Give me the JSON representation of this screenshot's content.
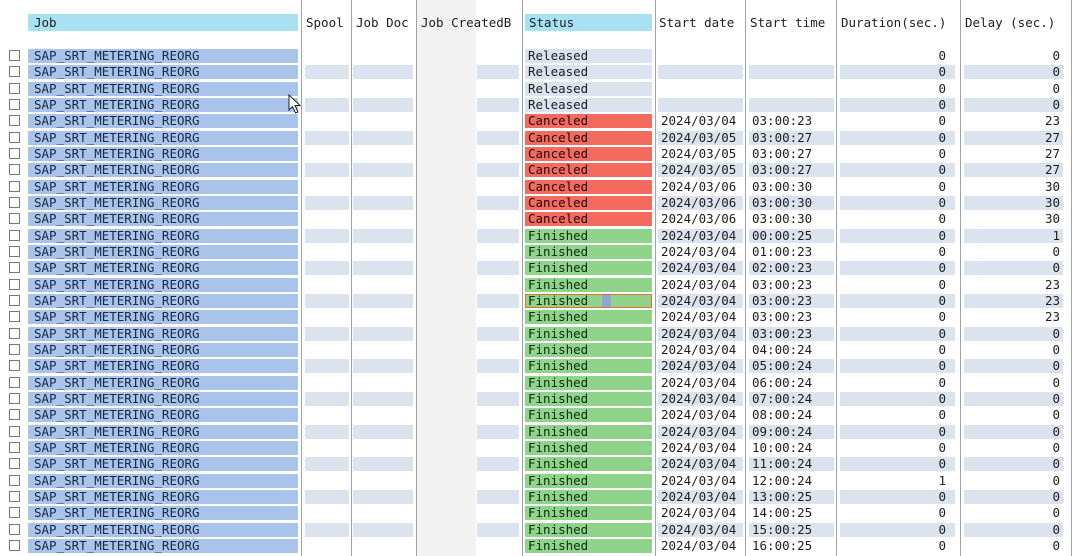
{
  "columns": {
    "job": "Job",
    "spool": "Spool",
    "job_doc": "Job Doc",
    "job_created_by": "Job CreatedB",
    "status": "Status",
    "start_date": "Start date",
    "start_time": "Start time",
    "duration": "Duration(sec.)",
    "delay": "Delay (sec.)"
  },
  "status_colors": {
    "Released": "#dbe3ee",
    "Canceled": "#f56a5e",
    "Finished": "#8fd48a"
  },
  "rows": [
    {
      "job": "SAP_SRT_METERING_REORG",
      "status": "Released",
      "start_date": "",
      "start_time": "",
      "duration": "0",
      "delay": "0"
    },
    {
      "job": "SAP_SRT_METERING_REORG",
      "status": "Released",
      "start_date": "",
      "start_time": "",
      "duration": "0",
      "delay": "0"
    },
    {
      "job": "SAP_SRT_METERING_REORG",
      "status": "Released",
      "start_date": "",
      "start_time": "",
      "duration": "0",
      "delay": "0"
    },
    {
      "job": "SAP_SRT_METERING_REORG",
      "status": "Released",
      "start_date": "",
      "start_time": "",
      "duration": "0",
      "delay": "0"
    },
    {
      "job": "SAP_SRT_METERING_REORG",
      "status": "Canceled",
      "start_date": "2024/03/04",
      "start_time": "03:00:23",
      "duration": "0",
      "delay": "23"
    },
    {
      "job": "SAP_SRT_METERING_REORG",
      "status": "Canceled",
      "start_date": "2024/03/05",
      "start_time": "03:00:27",
      "duration": "0",
      "delay": "27"
    },
    {
      "job": "SAP_SRT_METERING_REORG",
      "status": "Canceled",
      "start_date": "2024/03/05",
      "start_time": "03:00:27",
      "duration": "0",
      "delay": "27"
    },
    {
      "job": "SAP_SRT_METERING_REORG",
      "status": "Canceled",
      "start_date": "2024/03/05",
      "start_time": "03:00:27",
      "duration": "0",
      "delay": "27"
    },
    {
      "job": "SAP_SRT_METERING_REORG",
      "status": "Canceled",
      "start_date": "2024/03/06",
      "start_time": "03:00:30",
      "duration": "0",
      "delay": "30"
    },
    {
      "job": "SAP_SRT_METERING_REORG",
      "status": "Canceled",
      "start_date": "2024/03/06",
      "start_time": "03:00:30",
      "duration": "0",
      "delay": "30"
    },
    {
      "job": "SAP_SRT_METERING_REORG",
      "status": "Canceled",
      "start_date": "2024/03/06",
      "start_time": "03:00:30",
      "duration": "0",
      "delay": "30"
    },
    {
      "job": "SAP_SRT_METERING_REORG",
      "status": "Finished",
      "start_date": "2024/03/04",
      "start_time": "00:00:25",
      "duration": "0",
      "delay": "1"
    },
    {
      "job": "SAP_SRT_METERING_REORG",
      "status": "Finished",
      "start_date": "2024/03/04",
      "start_time": "01:00:23",
      "duration": "0",
      "delay": "0"
    },
    {
      "job": "SAP_SRT_METERING_REORG",
      "status": "Finished",
      "start_date": "2024/03/04",
      "start_time": "02:00:23",
      "duration": "0",
      "delay": "0"
    },
    {
      "job": "SAP_SRT_METERING_REORG",
      "status": "Finished",
      "start_date": "2024/03/04",
      "start_time": "03:00:23",
      "duration": "0",
      "delay": "23"
    },
    {
      "job": "SAP_SRT_METERING_REORG",
      "status": "Finished",
      "start_date": "2024/03/04",
      "start_time": "03:00:23",
      "duration": "0",
      "delay": "23",
      "focused": true
    },
    {
      "job": "SAP_SRT_METERING_REORG",
      "status": "Finished",
      "start_date": "2024/03/04",
      "start_time": "03:00:23",
      "duration": "0",
      "delay": "23"
    },
    {
      "job": "SAP_SRT_METERING_REORG",
      "status": "Finished",
      "start_date": "2024/03/04",
      "start_time": "03:00:23",
      "duration": "0",
      "delay": "0"
    },
    {
      "job": "SAP_SRT_METERING_REORG",
      "status": "Finished",
      "start_date": "2024/03/04",
      "start_time": "04:00:24",
      "duration": "0",
      "delay": "0"
    },
    {
      "job": "SAP_SRT_METERING_REORG",
      "status": "Finished",
      "start_date": "2024/03/04",
      "start_time": "05:00:24",
      "duration": "0",
      "delay": "0"
    },
    {
      "job": "SAP_SRT_METERING_REORG",
      "status": "Finished",
      "start_date": "2024/03/04",
      "start_time": "06:00:24",
      "duration": "0",
      "delay": "0"
    },
    {
      "job": "SAP_SRT_METERING_REORG",
      "status": "Finished",
      "start_date": "2024/03/04",
      "start_time": "07:00:24",
      "duration": "0",
      "delay": "0"
    },
    {
      "job": "SAP_SRT_METERING_REORG",
      "status": "Finished",
      "start_date": "2024/03/04",
      "start_time": "08:00:24",
      "duration": "0",
      "delay": "0"
    },
    {
      "job": "SAP_SRT_METERING_REORG",
      "status": "Finished",
      "start_date": "2024/03/04",
      "start_time": "09:00:24",
      "duration": "0",
      "delay": "0"
    },
    {
      "job": "SAP_SRT_METERING_REORG",
      "status": "Finished",
      "start_date": "2024/03/04",
      "start_time": "10:00:24",
      "duration": "0",
      "delay": "0"
    },
    {
      "job": "SAP_SRT_METERING_REORG",
      "status": "Finished",
      "start_date": "2024/03/04",
      "start_time": "11:00:24",
      "duration": "0",
      "delay": "0"
    },
    {
      "job": "SAP_SRT_METERING_REORG",
      "status": "Finished",
      "start_date": "2024/03/04",
      "start_time": "12:00:24",
      "duration": "1",
      "delay": "0"
    },
    {
      "job": "SAP_SRT_METERING_REORG",
      "status": "Finished",
      "start_date": "2024/03/04",
      "start_time": "13:00:25",
      "duration": "0",
      "delay": "0"
    },
    {
      "job": "SAP_SRT_METERING_REORG",
      "status": "Finished",
      "start_date": "2024/03/04",
      "start_time": "14:00:25",
      "duration": "0",
      "delay": "0"
    },
    {
      "job": "SAP_SRT_METERING_REORG",
      "status": "Finished",
      "start_date": "2024/03/04",
      "start_time": "15:00:25",
      "duration": "0",
      "delay": "0"
    },
    {
      "job": "SAP_SRT_METERING_REORG",
      "status": "Finished",
      "start_date": "2024/03/04",
      "start_time": "16:00:25",
      "duration": "0",
      "delay": "0"
    }
  ]
}
